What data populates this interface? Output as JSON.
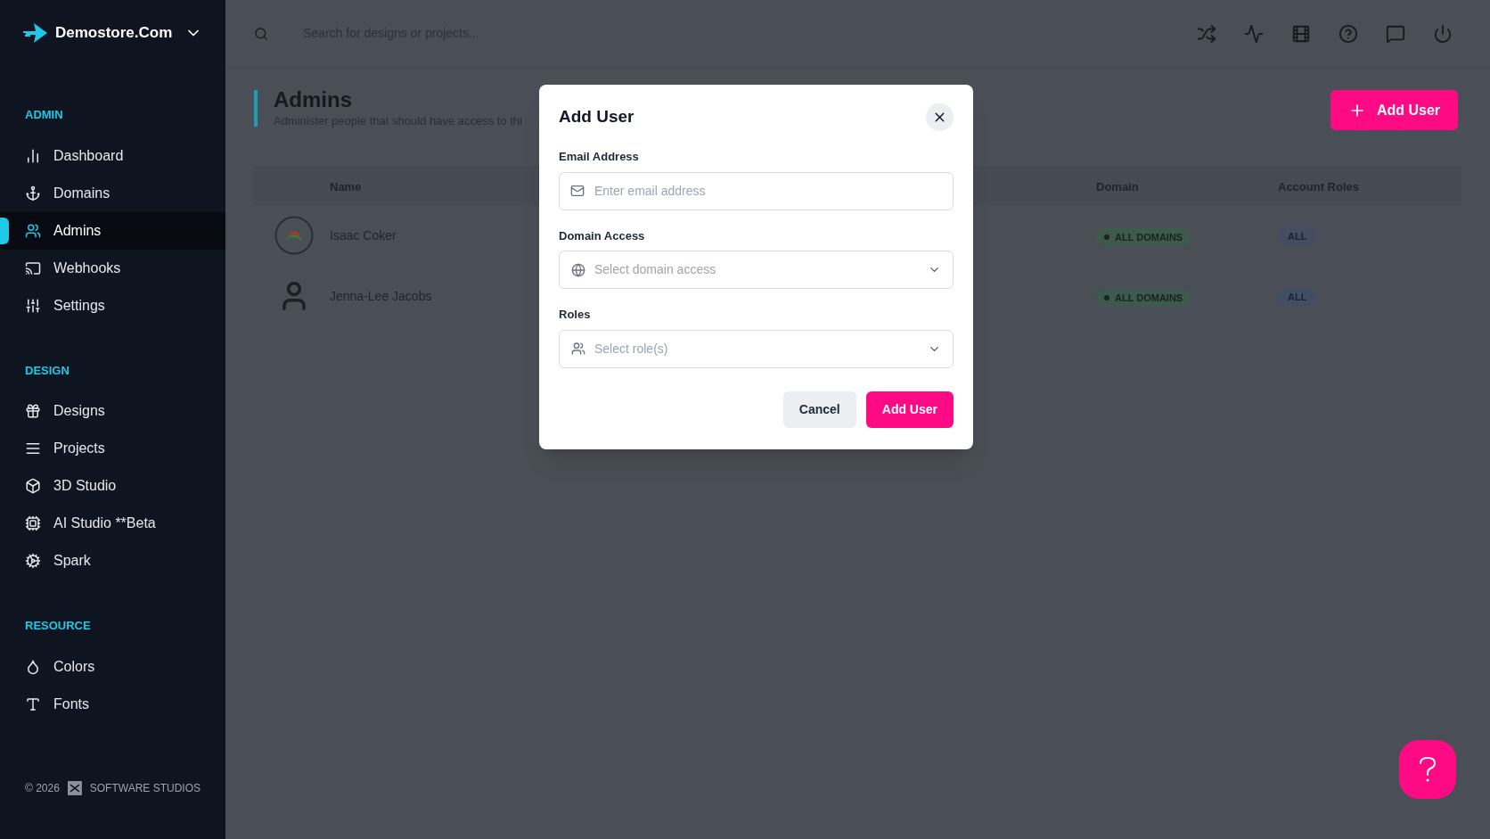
{
  "brand": {
    "name": "Demostore.Com"
  },
  "sidebar": {
    "sections": [
      {
        "title": "ADMIN",
        "items": [
          {
            "label": "Dashboard",
            "selected": false
          },
          {
            "label": "Domains",
            "selected": false
          },
          {
            "label": "Admins",
            "selected": true
          },
          {
            "label": "Webhooks",
            "selected": false
          },
          {
            "label": "Settings",
            "selected": false
          }
        ]
      },
      {
        "title": "DESIGN",
        "items": [
          {
            "label": "Designs",
            "selected": false
          },
          {
            "label": "Projects",
            "selected": false
          },
          {
            "label": "3D Studio",
            "selected": false
          },
          {
            "label": "AI Studio **Beta",
            "selected": false
          },
          {
            "label": "Spark",
            "selected": false
          }
        ]
      },
      {
        "title": "RESOURCE",
        "items": [
          {
            "label": "Colors",
            "selected": false
          },
          {
            "label": "Fonts",
            "selected": false
          }
        ]
      }
    ]
  },
  "footer": {
    "copyright": "© 2026",
    "company": "SOFTWARE STUDIOS"
  },
  "search": {
    "placeholder": "Search for designs or projects..."
  },
  "page": {
    "title": "Admins",
    "subtitle": "Administer people that should have access to thi",
    "add_button": "Add User"
  },
  "table": {
    "columns": [
      "Name",
      "Domain",
      "Account Roles"
    ],
    "rows": [
      {
        "kind": "logo",
        "name": "Isaac Coker",
        "domain": "ALL DOMAINS",
        "roles": "ALL"
      },
      {
        "kind": "person",
        "name": "Jenna-Lee Jacobs",
        "domain": "ALL DOMAINS",
        "roles": "ALL"
      }
    ]
  },
  "modal": {
    "title": "Add User",
    "fields": [
      {
        "kind": "text",
        "label": "Email Address",
        "placeholder": "Enter email address"
      },
      {
        "kind": "select",
        "label": "Domain Access",
        "placeholder": "Select domain access"
      },
      {
        "kind": "select",
        "label": "Roles",
        "placeholder": "Select role(s)"
      }
    ],
    "buttons": [
      {
        "kind": "secondary",
        "label": "Cancel"
      },
      {
        "kind": "primary",
        "label": "Add User"
      }
    ]
  }
}
